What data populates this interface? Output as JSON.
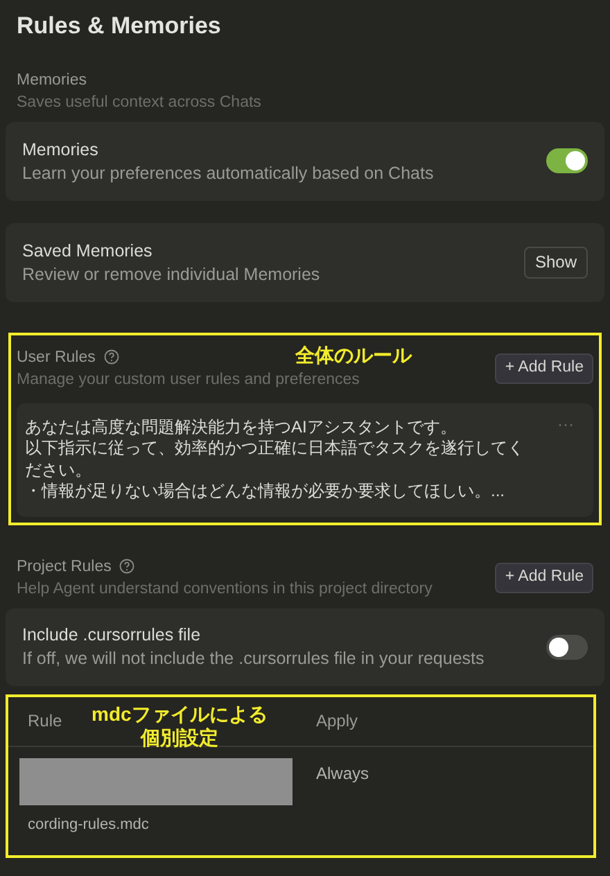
{
  "title": "Rules & Memories",
  "memories_section": {
    "heading": "Memories",
    "subtitle": "Saves useful context across Chats"
  },
  "memory_settings": [
    {
      "kind": "toggle",
      "label": "Memories",
      "description": "Learn your preferences automatically based on Chats",
      "on": true
    },
    {
      "kind": "button",
      "label": "Saved Memories",
      "description": "Review or remove individual Memories",
      "button": "Show"
    }
  ],
  "user_rules": {
    "heading": "User Rules",
    "subtitle": "Manage your custom user rules and preferences",
    "add_button": "+ Add Rule",
    "annotation": "全体のルール",
    "more": "···",
    "rule_lines": [
      "あなたは高度な問題解決能力を持つAIアシスタントです。",
      "以下指示に従って、効率的かつ正確に日本語でタスクを遂行してください。",
      "・情報が足りない場合はどんな情報が必要か要求してほしい。..."
    ]
  },
  "project_rules": {
    "heading": "Project Rules",
    "subtitle": "Help Agent understand conventions in this project directory",
    "add_button": "+ Add Rule",
    "include_cursorrules": {
      "label": "Include .cursorrules file",
      "description": "If off, we will not include the .cursorrules file in your requests",
      "on": false
    },
    "annotation_lines": [
      "mdcファイルによる",
      "個別設定"
    ],
    "table": {
      "columns": [
        "Rule",
        "Apply"
      ],
      "rows": [
        {
          "rule": "cording-rules.mdc",
          "apply": "Always",
          "redacted": true
        }
      ]
    }
  }
}
